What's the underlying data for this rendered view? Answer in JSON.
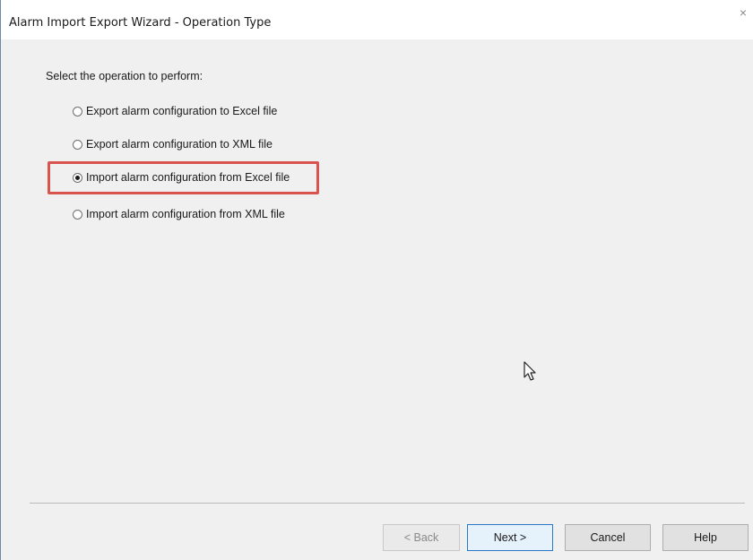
{
  "window": {
    "title": "Alarm Import Export Wizard - Operation Type",
    "close_glyph": "×"
  },
  "prompt": "Select the operation to perform:",
  "options": [
    {
      "label": "Export alarm configuration to Excel file",
      "selected": false
    },
    {
      "label": "Export alarm configuration to XML file",
      "selected": false
    },
    {
      "label": "Import alarm configuration from Excel file",
      "selected": true
    },
    {
      "label": "Import alarm configuration from XML file",
      "selected": false
    }
  ],
  "buttons": {
    "back": "< Back",
    "next": "Next >",
    "cancel": "Cancel",
    "help": "Help"
  },
  "colors": {
    "highlight": "#d9534f",
    "default_button_border": "#2b77c8"
  }
}
